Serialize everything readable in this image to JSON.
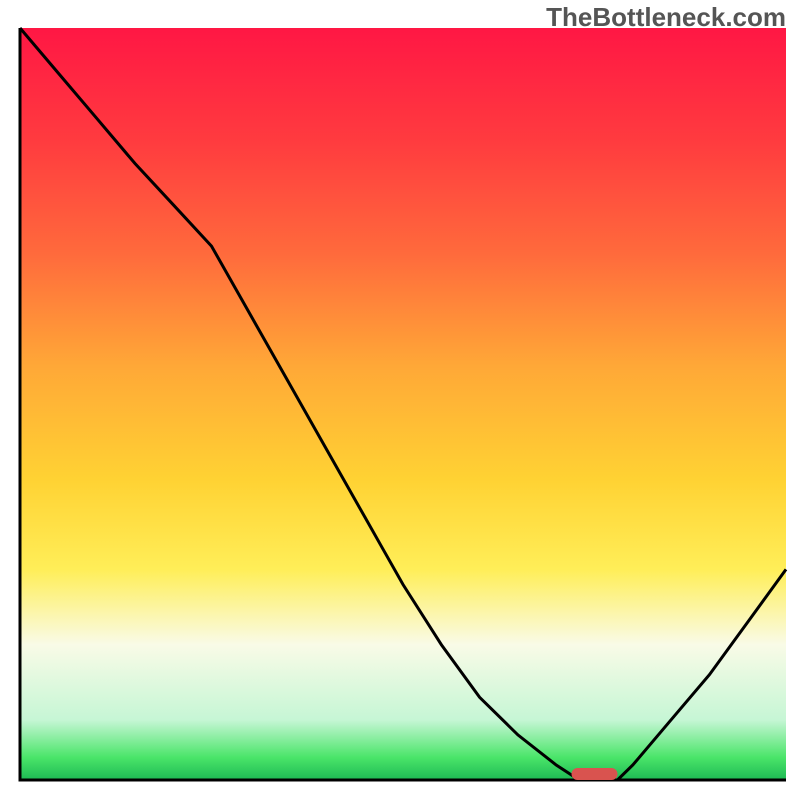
{
  "watermark": "TheBottleneck.com",
  "chart_data": {
    "type": "line",
    "title": "",
    "xlabel": "",
    "ylabel": "",
    "xlim": [
      0,
      100
    ],
    "ylim": [
      0,
      100
    ],
    "x": [
      0,
      5,
      10,
      15,
      20,
      25,
      30,
      35,
      40,
      45,
      50,
      55,
      60,
      65,
      70,
      73,
      75,
      78,
      80,
      85,
      90,
      95,
      100
    ],
    "values": [
      100,
      94,
      88,
      82,
      76.5,
      71,
      62,
      53,
      44,
      35,
      26,
      18,
      11,
      6,
      2,
      0,
      0,
      0,
      2,
      8,
      14,
      21,
      28
    ],
    "marker": {
      "x_start": 72,
      "x_end": 78,
      "y": 0,
      "color": "#d9534f"
    },
    "gradient_stops": [
      {
        "offset": 0.0,
        "color": "#ff1744"
      },
      {
        "offset": 0.15,
        "color": "#ff3b3f"
      },
      {
        "offset": 0.3,
        "color": "#ff6a3c"
      },
      {
        "offset": 0.45,
        "color": "#ffa837"
      },
      {
        "offset": 0.6,
        "color": "#ffd233"
      },
      {
        "offset": 0.72,
        "color": "#ffee58"
      },
      {
        "offset": 0.82,
        "color": "#f9fbe7"
      },
      {
        "offset": 0.92,
        "color": "#c6f6d5"
      },
      {
        "offset": 0.97,
        "color": "#4ae569"
      },
      {
        "offset": 1.0,
        "color": "#1db954"
      }
    ],
    "axis_color": "#000000",
    "curve_color": "#000000",
    "curve_width": 3
  }
}
